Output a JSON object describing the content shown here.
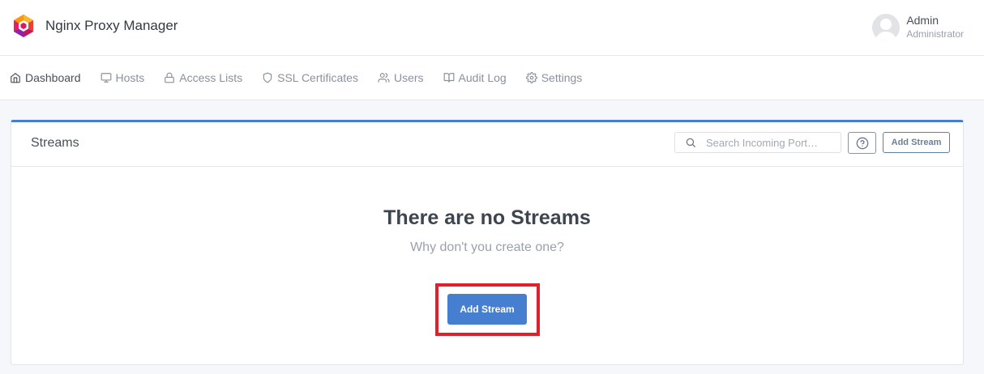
{
  "app": {
    "title": "Nginx Proxy Manager"
  },
  "user": {
    "name": "Admin",
    "role": "Administrator"
  },
  "nav": {
    "items": [
      {
        "label": "Dashboard",
        "icon": "home-icon"
      },
      {
        "label": "Hosts",
        "icon": "monitor-icon"
      },
      {
        "label": "Access Lists",
        "icon": "lock-icon"
      },
      {
        "label": "SSL Certificates",
        "icon": "shield-icon"
      },
      {
        "label": "Users",
        "icon": "users-icon"
      },
      {
        "label": "Audit Log",
        "icon": "book-open-icon"
      },
      {
        "label": "Settings",
        "icon": "gear-icon"
      }
    ]
  },
  "streams": {
    "title": "Streams",
    "search_placeholder": "Search Incoming Port…",
    "add_button_label": "Add Stream",
    "empty_title": "There are no Streams",
    "empty_subtitle": "Why don't you create one?",
    "empty_add_button_label": "Add Stream"
  },
  "colors": {
    "primary": "#467fcf",
    "highlight": "#e0202a"
  }
}
